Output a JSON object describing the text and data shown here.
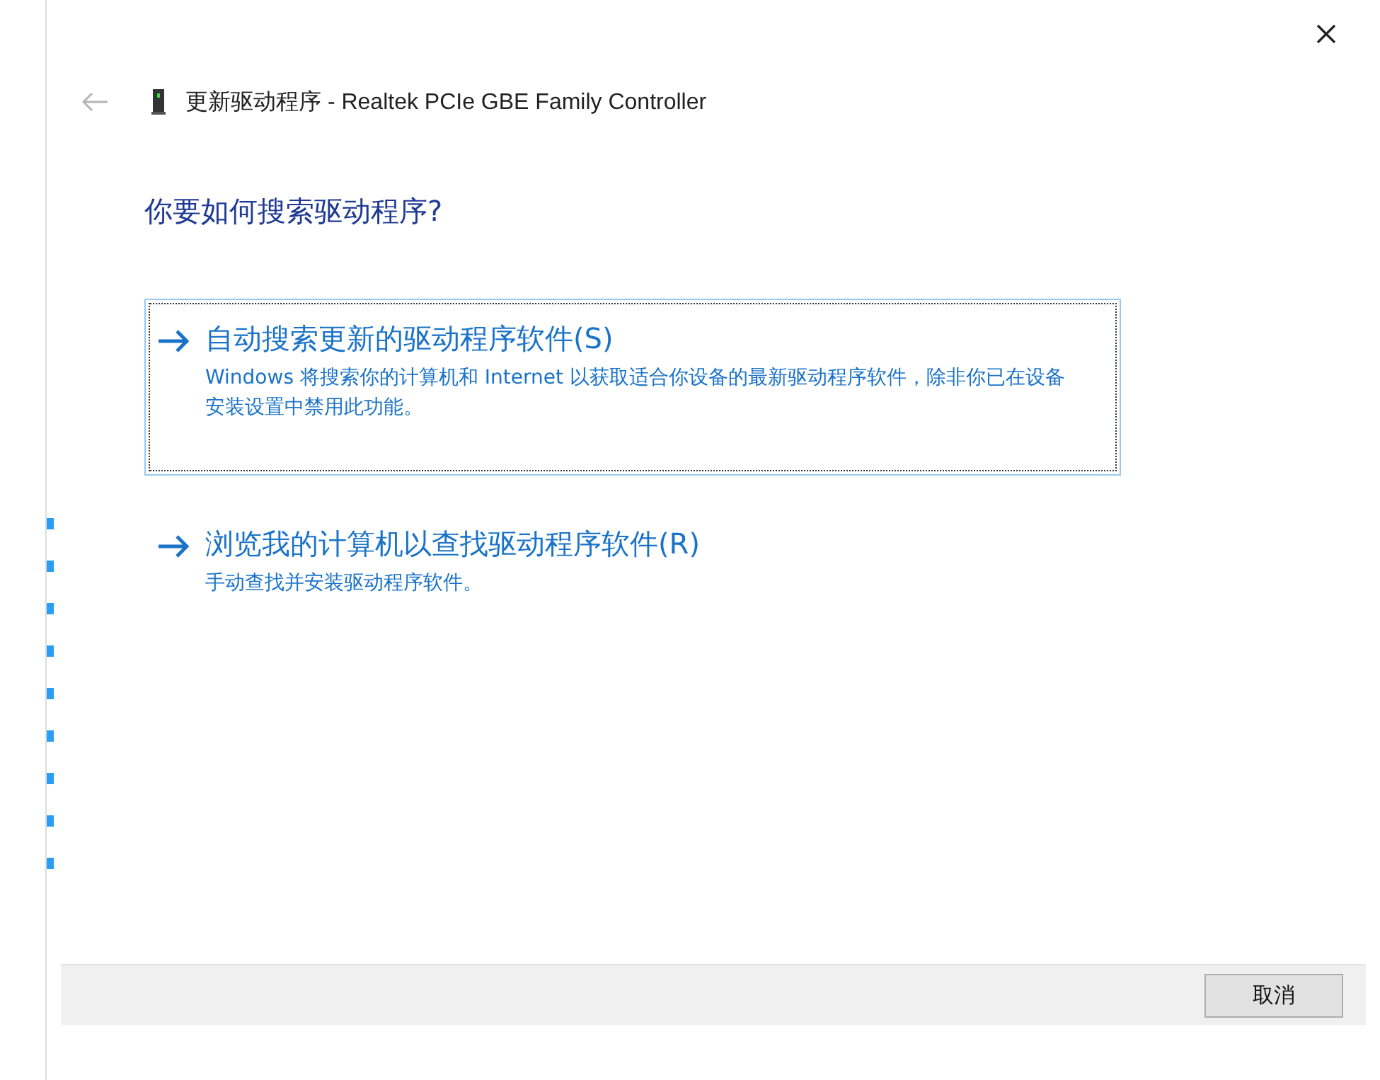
{
  "window": {
    "title": "更新驱动程序 - Realtek PCIe GBE Family Controller",
    "back_disabled": true
  },
  "heading": "你要如何搜索驱动程序?",
  "options": [
    {
      "title": "自动搜索更新的驱动程序软件(S)",
      "description": "Windows 将搜索你的计算机和 Internet 以获取适合你设备的最新驱动程序软件，除非你已在设备安装设置中禁用此功能。",
      "selected": true
    },
    {
      "title": "浏览我的计算机以查找驱动程序软件(R)",
      "description": "手动查找并安装驱动程序软件。",
      "selected": false
    }
  ],
  "buttons": [
    "取消"
  ]
}
